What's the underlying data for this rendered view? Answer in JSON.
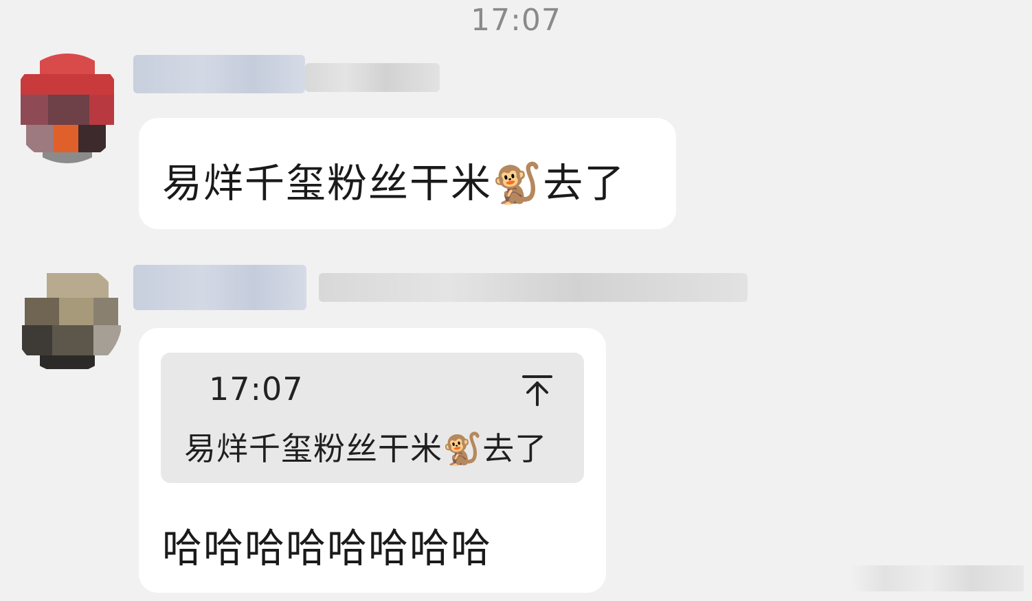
{
  "chat": {
    "timestamp": "17:07",
    "messages": [
      {
        "sender": "",
        "text": "易烊千玺粉丝干米🐒去了"
      },
      {
        "sender": "",
        "quote": {
          "time": "17:07",
          "text": "易烊千玺粉丝干米🐒去了"
        },
        "text": "哈哈哈哈哈哈哈哈"
      }
    ]
  },
  "icons": {
    "quote_pin": "pin-to-top-icon"
  },
  "colors": {
    "background": "#f1f1f1",
    "bubble": "#ffffff",
    "quote_bg": "#e8e8e8"
  }
}
